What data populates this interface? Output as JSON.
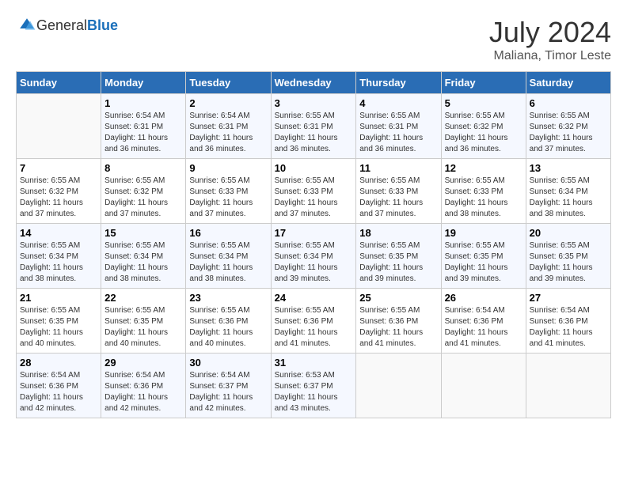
{
  "header": {
    "logo_general": "General",
    "logo_blue": "Blue",
    "month": "July 2024",
    "location": "Maliana, Timor Leste"
  },
  "days_of_week": [
    "Sunday",
    "Monday",
    "Tuesday",
    "Wednesday",
    "Thursday",
    "Friday",
    "Saturday"
  ],
  "weeks": [
    [
      {
        "day": "",
        "sunrise": "",
        "sunset": "",
        "daylight": ""
      },
      {
        "day": "1",
        "sunrise": "Sunrise: 6:54 AM",
        "sunset": "Sunset: 6:31 PM",
        "daylight": "Daylight: 11 hours and 36 minutes."
      },
      {
        "day": "2",
        "sunrise": "Sunrise: 6:54 AM",
        "sunset": "Sunset: 6:31 PM",
        "daylight": "Daylight: 11 hours and 36 minutes."
      },
      {
        "day": "3",
        "sunrise": "Sunrise: 6:55 AM",
        "sunset": "Sunset: 6:31 PM",
        "daylight": "Daylight: 11 hours and 36 minutes."
      },
      {
        "day": "4",
        "sunrise": "Sunrise: 6:55 AM",
        "sunset": "Sunset: 6:31 PM",
        "daylight": "Daylight: 11 hours and 36 minutes."
      },
      {
        "day": "5",
        "sunrise": "Sunrise: 6:55 AM",
        "sunset": "Sunset: 6:32 PM",
        "daylight": "Daylight: 11 hours and 36 minutes."
      },
      {
        "day": "6",
        "sunrise": "Sunrise: 6:55 AM",
        "sunset": "Sunset: 6:32 PM",
        "daylight": "Daylight: 11 hours and 37 minutes."
      }
    ],
    [
      {
        "day": "7",
        "sunrise": "Sunrise: 6:55 AM",
        "sunset": "Sunset: 6:32 PM",
        "daylight": "Daylight: 11 hours and 37 minutes."
      },
      {
        "day": "8",
        "sunrise": "Sunrise: 6:55 AM",
        "sunset": "Sunset: 6:32 PM",
        "daylight": "Daylight: 11 hours and 37 minutes."
      },
      {
        "day": "9",
        "sunrise": "Sunrise: 6:55 AM",
        "sunset": "Sunset: 6:33 PM",
        "daylight": "Daylight: 11 hours and 37 minutes."
      },
      {
        "day": "10",
        "sunrise": "Sunrise: 6:55 AM",
        "sunset": "Sunset: 6:33 PM",
        "daylight": "Daylight: 11 hours and 37 minutes."
      },
      {
        "day": "11",
        "sunrise": "Sunrise: 6:55 AM",
        "sunset": "Sunset: 6:33 PM",
        "daylight": "Daylight: 11 hours and 37 minutes."
      },
      {
        "day": "12",
        "sunrise": "Sunrise: 6:55 AM",
        "sunset": "Sunset: 6:33 PM",
        "daylight": "Daylight: 11 hours and 38 minutes."
      },
      {
        "day": "13",
        "sunrise": "Sunrise: 6:55 AM",
        "sunset": "Sunset: 6:34 PM",
        "daylight": "Daylight: 11 hours and 38 minutes."
      }
    ],
    [
      {
        "day": "14",
        "sunrise": "Sunrise: 6:55 AM",
        "sunset": "Sunset: 6:34 PM",
        "daylight": "Daylight: 11 hours and 38 minutes."
      },
      {
        "day": "15",
        "sunrise": "Sunrise: 6:55 AM",
        "sunset": "Sunset: 6:34 PM",
        "daylight": "Daylight: 11 hours and 38 minutes."
      },
      {
        "day": "16",
        "sunrise": "Sunrise: 6:55 AM",
        "sunset": "Sunset: 6:34 PM",
        "daylight": "Daylight: 11 hours and 38 minutes."
      },
      {
        "day": "17",
        "sunrise": "Sunrise: 6:55 AM",
        "sunset": "Sunset: 6:34 PM",
        "daylight": "Daylight: 11 hours and 39 minutes."
      },
      {
        "day": "18",
        "sunrise": "Sunrise: 6:55 AM",
        "sunset": "Sunset: 6:35 PM",
        "daylight": "Daylight: 11 hours and 39 minutes."
      },
      {
        "day": "19",
        "sunrise": "Sunrise: 6:55 AM",
        "sunset": "Sunset: 6:35 PM",
        "daylight": "Daylight: 11 hours and 39 minutes."
      },
      {
        "day": "20",
        "sunrise": "Sunrise: 6:55 AM",
        "sunset": "Sunset: 6:35 PM",
        "daylight": "Daylight: 11 hours and 39 minutes."
      }
    ],
    [
      {
        "day": "21",
        "sunrise": "Sunrise: 6:55 AM",
        "sunset": "Sunset: 6:35 PM",
        "daylight": "Daylight: 11 hours and 40 minutes."
      },
      {
        "day": "22",
        "sunrise": "Sunrise: 6:55 AM",
        "sunset": "Sunset: 6:35 PM",
        "daylight": "Daylight: 11 hours and 40 minutes."
      },
      {
        "day": "23",
        "sunrise": "Sunrise: 6:55 AM",
        "sunset": "Sunset: 6:36 PM",
        "daylight": "Daylight: 11 hours and 40 minutes."
      },
      {
        "day": "24",
        "sunrise": "Sunrise: 6:55 AM",
        "sunset": "Sunset: 6:36 PM",
        "daylight": "Daylight: 11 hours and 41 minutes."
      },
      {
        "day": "25",
        "sunrise": "Sunrise: 6:55 AM",
        "sunset": "Sunset: 6:36 PM",
        "daylight": "Daylight: 11 hours and 41 minutes."
      },
      {
        "day": "26",
        "sunrise": "Sunrise: 6:54 AM",
        "sunset": "Sunset: 6:36 PM",
        "daylight": "Daylight: 11 hours and 41 minutes."
      },
      {
        "day": "27",
        "sunrise": "Sunrise: 6:54 AM",
        "sunset": "Sunset: 6:36 PM",
        "daylight": "Daylight: 11 hours and 41 minutes."
      }
    ],
    [
      {
        "day": "28",
        "sunrise": "Sunrise: 6:54 AM",
        "sunset": "Sunset: 6:36 PM",
        "daylight": "Daylight: 11 hours and 42 minutes."
      },
      {
        "day": "29",
        "sunrise": "Sunrise: 6:54 AM",
        "sunset": "Sunset: 6:36 PM",
        "daylight": "Daylight: 11 hours and 42 minutes."
      },
      {
        "day": "30",
        "sunrise": "Sunrise: 6:54 AM",
        "sunset": "Sunset: 6:37 PM",
        "daylight": "Daylight: 11 hours and 42 minutes."
      },
      {
        "day": "31",
        "sunrise": "Sunrise: 6:53 AM",
        "sunset": "Sunset: 6:37 PM",
        "daylight": "Daylight: 11 hours and 43 minutes."
      },
      {
        "day": "",
        "sunrise": "",
        "sunset": "",
        "daylight": ""
      },
      {
        "day": "",
        "sunrise": "",
        "sunset": "",
        "daylight": ""
      },
      {
        "day": "",
        "sunrise": "",
        "sunset": "",
        "daylight": ""
      }
    ]
  ]
}
